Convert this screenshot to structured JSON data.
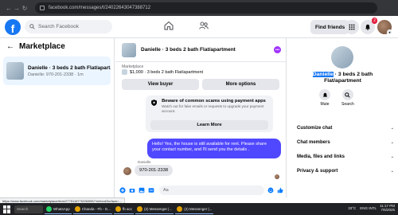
{
  "browser": {
    "url_host": "facebook.com",
    "url_path": "/messages/t/24022643047388712"
  },
  "header": {
    "search_placeholder": "Search Facebook",
    "find_friends": "Find friends",
    "notif_count": "2"
  },
  "left": {
    "title": "Marketplace",
    "conversation": {
      "title": "Danielle · 3 beds 2 bath Flat/apart...",
      "subtitle": "Danielle: 970-201-2338 · 1m"
    }
  },
  "chat": {
    "title": "Danielle · 3 beds 2 bath Flat/apartment",
    "listing_label": "Marketplace",
    "listing_price": "$1,000 · 3 beds 2 bath Flat/apartment",
    "view_buyer": "View buyer",
    "more_options": "More options",
    "scam_title": "Beware of common scams using payment apps",
    "scam_desc": "Watch out for fake emails or requests to upgrade your payment account.",
    "learn_more": "Learn More",
    "outgoing_message": "Hello! Yes, the house is still available for rent. Please share your contact number, and I'll send you the details .",
    "sender_name": "Danielle",
    "incoming_message": "970-201-2338",
    "composer_placeholder": "Aa"
  },
  "right": {
    "title_highlight": "Danielle",
    "title_rest": " · 3 beds 2 bath Flat/apartment",
    "mute": "Mute",
    "search": "Search",
    "menu": [
      "Customize chat",
      "Chat members",
      "Media, files and links",
      "Privacy & support"
    ]
  },
  "status_url": "https://www.facebook.com/marketplace/item/2775116776336595/?referralSurface=...",
  "taskbar": {
    "search": "Search",
    "apps": [
      "WhatsApp",
      "Chanda - Fb - G...",
      "fb acc",
      "(2) Messenger |...",
      "(2) Messenger |..."
    ],
    "temp": "33°C",
    "lang": "ENG\nINTL",
    "time": "11:17 PM",
    "date": "7/6/2025"
  },
  "colors": {
    "fb_blue": "#1877f2",
    "bubble_out": "#5048ff",
    "notif_red": "#e41e3f"
  }
}
